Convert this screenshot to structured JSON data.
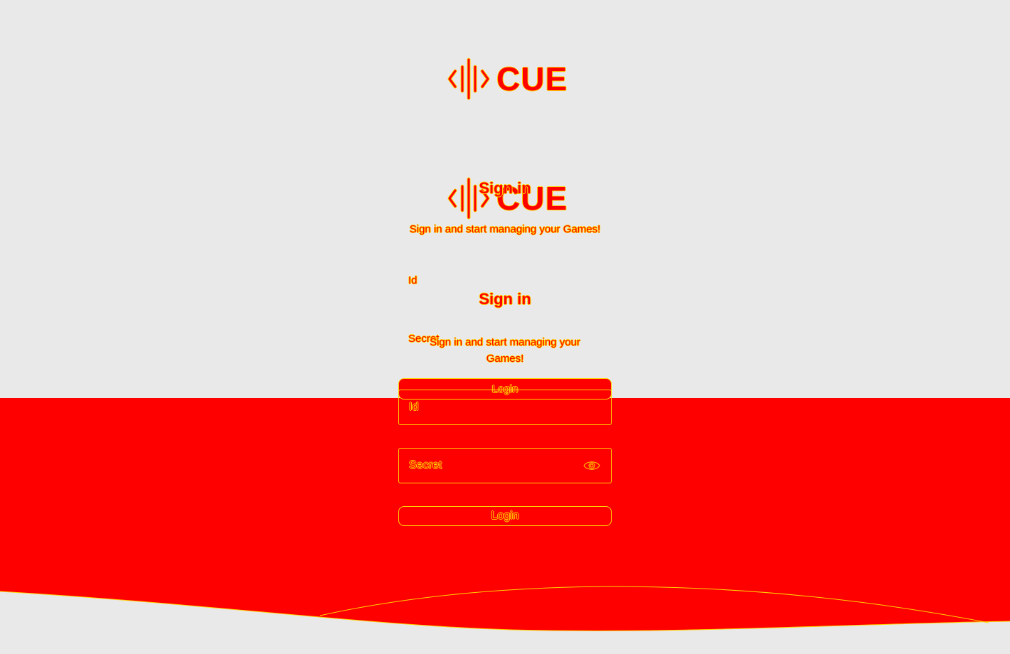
{
  "brand": {
    "name": "CUE",
    "icon": "cue-logo-icon"
  },
  "ghost": {
    "title": "Sign in",
    "subtitle": "Sign in and start managing your Games!",
    "id_label": "Id",
    "secret_label": "Secret",
    "login_label": "Login"
  },
  "form": {
    "title": "Sign in",
    "subtitle": "Sign in and start managing your Games!",
    "id_placeholder": "Id",
    "secret_placeholder": "Secret",
    "login_label": "Login",
    "reveal_icon": "eye-icon"
  },
  "colors": {
    "background": "#e9e9e9",
    "accent": "#ff0000",
    "outline": "#ffd200"
  }
}
